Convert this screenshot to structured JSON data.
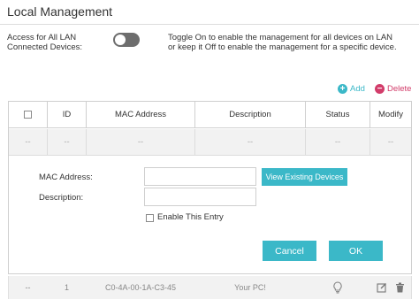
{
  "title": "Local Management",
  "access": {
    "label": "Access for All LAN Connected Devices:",
    "toggle_on": false,
    "description": "Toggle On to enable the management for all devices on LAN or keep it Off to enable the management for a specific device."
  },
  "actions": {
    "add": "Add",
    "delete": "Delete"
  },
  "table": {
    "columns": [
      "ID",
      "MAC Address",
      "Description",
      "Status",
      "Modify"
    ],
    "empty_row": [
      "--",
      "--",
      "--",
      "--",
      "--",
      "--"
    ],
    "row": {
      "select": "--",
      "id": "1",
      "mac": "C0-4A-00-1A-C3-45",
      "description": "Your PC!"
    }
  },
  "form": {
    "mac_label": "MAC Address:",
    "mac_value": "",
    "description_label": "Description:",
    "description_value": "",
    "view_devices": "View Existing Devices",
    "enable_entry": "Enable This Entry",
    "cancel": "Cancel",
    "ok": "OK"
  },
  "colors": {
    "accent": "#3bb8c8",
    "delete": "#d23c6a",
    "toggle_off": "#6d6d6d"
  },
  "icons": {
    "add": "plus-circle-icon",
    "delete": "minus-circle-icon",
    "status": "lightbulb-icon",
    "edit": "edit-icon",
    "trash": "trash-icon"
  }
}
